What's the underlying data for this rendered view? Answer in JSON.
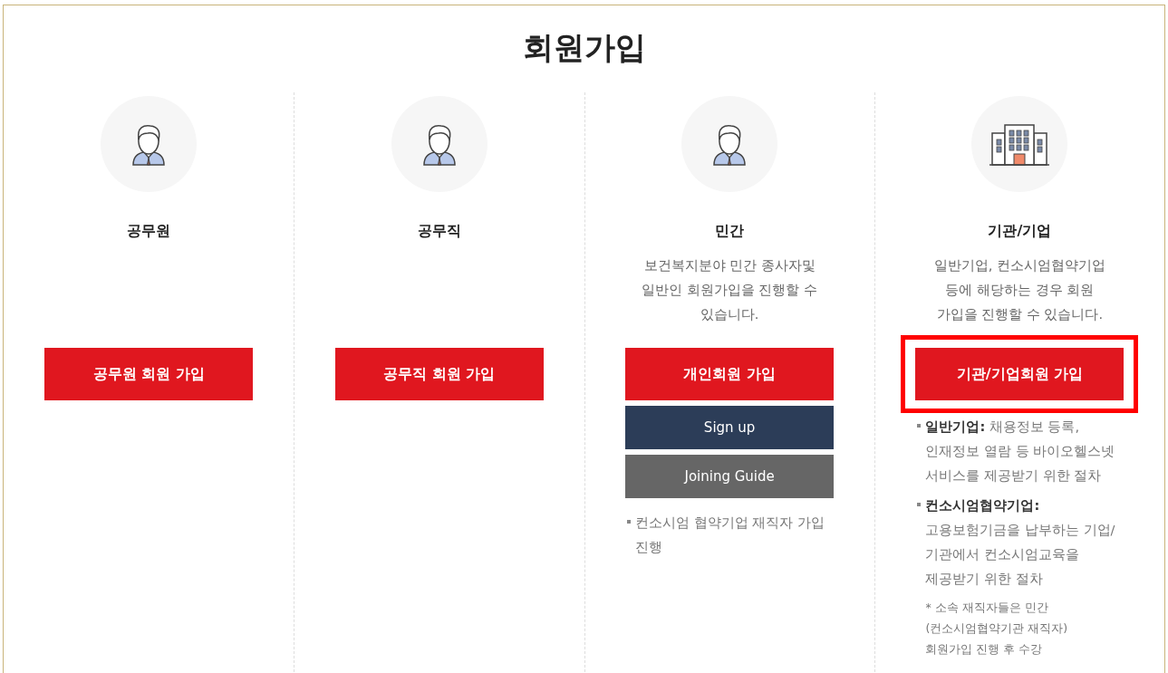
{
  "title": "회원가입",
  "columns": [
    {
      "kind": "individual",
      "name": "공무원",
      "buttons": [
        {
          "label": "공무원 회원 가입",
          "kind": "primary",
          "highlighted": false
        }
      ]
    },
    {
      "kind": "individual",
      "name": "공무직",
      "buttons": [
        {
          "label": "공무직 회원 가입",
          "kind": "primary",
          "highlighted": false
        }
      ]
    },
    {
      "kind": "individual",
      "name": "민간",
      "description": "보건복지분야 민간 종사자및 일반인 회원가입을 진행할 수 있습니다.",
      "buttons": [
        {
          "label": "개인회원 가입",
          "kind": "primary",
          "highlighted": false
        },
        {
          "label": "Sign up",
          "kind": "dark",
          "highlighted": false
        },
        {
          "label": "Joining Guide",
          "kind": "gray",
          "highlighted": false
        }
      ],
      "notes": [
        "컨소시엄 협약기업 재직자 가입 진행"
      ]
    },
    {
      "kind": "organization",
      "name": "기관/기업",
      "description": "일반기업, 컨소시엄협약기업 등에 해당하는 경우 회원 가입을 진행할 수 있습니다.",
      "buttons": [
        {
          "label": "기관/기업회원 가입",
          "kind": "primary",
          "highlighted": true
        }
      ],
      "notes": [
        "**일반기업:** 채용정보 등록, 인재정보 열람 등 바이오헬스넷 서비스를 제공받기 위한 절차",
        "**컨소시엄협약기업:** 고용보험기금을 납부하는 기업/기관에서 컨소시엄교육을 제공받기 위한 절차"
      ],
      "footnote": "* 소속 재직자들은 민간 (컨소시엄협약기관 재직자) 회원가입 진행 후 수강"
    }
  ]
}
